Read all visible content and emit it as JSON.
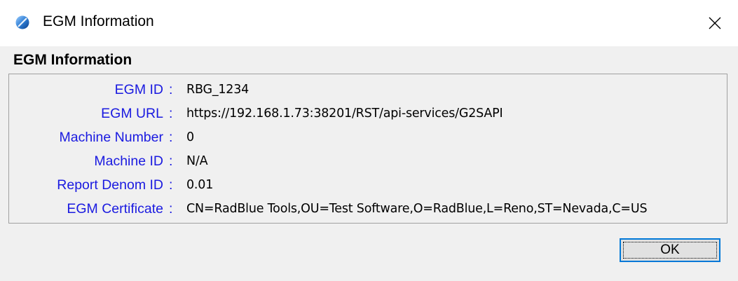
{
  "window": {
    "title": "EGM Information",
    "icon": "blue-globe-icon",
    "close_icon": "close-icon"
  },
  "group": {
    "title": "EGM Information",
    "rows": [
      {
        "label": "EGM ID",
        "colon": ":",
        "value": "RBG_1234"
      },
      {
        "label": "EGM URL",
        "colon": ":",
        "value": "https://192.168.1.73:38201/RST/api-services/G2SAPI"
      },
      {
        "label": "Machine Number",
        "colon": ":",
        "value": "0"
      },
      {
        "label": "Machine ID",
        "colon": ":",
        "value": "N/A"
      },
      {
        "label": "Report Denom ID",
        "colon": ":",
        "value": "0.01"
      },
      {
        "label": "EGM Certificate",
        "colon": ":",
        "value": "CN=RadBlue Tools,OU=Test Software,O=RadBlue,L=Reno,ST=Nevada,C=US"
      }
    ]
  },
  "buttons": {
    "ok_label": "OK"
  },
  "colors": {
    "label_blue": "#1a1ae0",
    "accent": "#0078d7"
  }
}
